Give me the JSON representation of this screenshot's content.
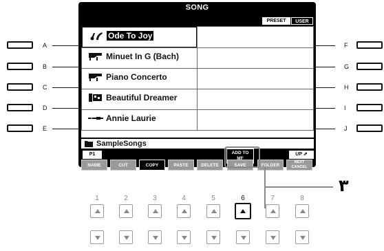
{
  "screen": {
    "title": "SONG",
    "tabs": {
      "preset": "PRESET",
      "user": "USER"
    }
  },
  "songs": [
    {
      "side": "A",
      "name": "Ode To Joy",
      "icon": "voice-song-icon",
      "selected": true
    },
    {
      "side": "B",
      "name": "Minuet In G (Bach)",
      "icon": "grand-piano-icon",
      "selected": false
    },
    {
      "side": "C",
      "name": "Piano Concerto",
      "icon": "grand-piano-icon",
      "selected": false
    },
    {
      "side": "D",
      "name": "Beautiful Dreamer",
      "icon": "keyboard-style-icon",
      "selected": false
    },
    {
      "side": "E",
      "name": "Annie Laurie",
      "icon": "flute-icon",
      "selected": false
    }
  ],
  "right_buttons": [
    "F",
    "G",
    "H",
    "I",
    "J"
  ],
  "folder": {
    "name": "SampleSongs"
  },
  "page_tab": "P1",
  "up_button": "UP",
  "add_to_mf": {
    "line1": "ADD TO",
    "line2": "MF"
  },
  "soft_buttons": [
    "NAME",
    "CUT",
    "COPY",
    "PASTE",
    "DELETE",
    "SAVE",
    "FOLDER",
    "NEXT CANCEL"
  ],
  "soft_active": "COPY",
  "number_buttons": [
    "1",
    "2",
    "3",
    "4",
    "5",
    "6",
    "7",
    "8"
  ],
  "highlighted_number": "6",
  "callout": "٣"
}
